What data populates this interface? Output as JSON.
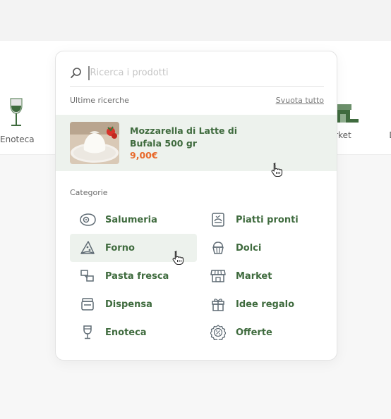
{
  "background": {
    "categories": [
      {
        "label": "Enoteca"
      },
      {
        "label": "rket"
      },
      {
        "label": "D"
      }
    ]
  },
  "search": {
    "placeholder": "Ricerca i prodotti",
    "value": ""
  },
  "recent": {
    "title": "Ultime ricerche",
    "clear_label": "Svuota tutto",
    "items": [
      {
        "line1": "Mozzarella di Latte di",
        "line2": "Bufala 500 gr",
        "price": "9,00€"
      }
    ]
  },
  "categories": {
    "title": "Categorie",
    "left": [
      {
        "label": "Salumeria",
        "icon": "ham-icon"
      },
      {
        "label": "Forno",
        "icon": "pizza-slice-icon"
      },
      {
        "label": "Pasta fresca",
        "icon": "pasta-icon"
      },
      {
        "label": "Dispensa",
        "icon": "pantry-jar-icon"
      },
      {
        "label": "Enoteca",
        "icon": "wine-glass-icon"
      }
    ],
    "right": [
      {
        "label": "Piatti pronti",
        "icon": "ready-meal-icon"
      },
      {
        "label": "Dolci",
        "icon": "cupcake-icon"
      },
      {
        "label": "Market",
        "icon": "store-icon"
      },
      {
        "label": "Idee regalo",
        "icon": "gift-icon"
      },
      {
        "label": "Offerte",
        "icon": "discount-badge-icon"
      }
    ]
  },
  "colors": {
    "brand_green": "#3f6b3e",
    "price_orange": "#e86a2c",
    "highlight_bg": "#edf2ed"
  }
}
